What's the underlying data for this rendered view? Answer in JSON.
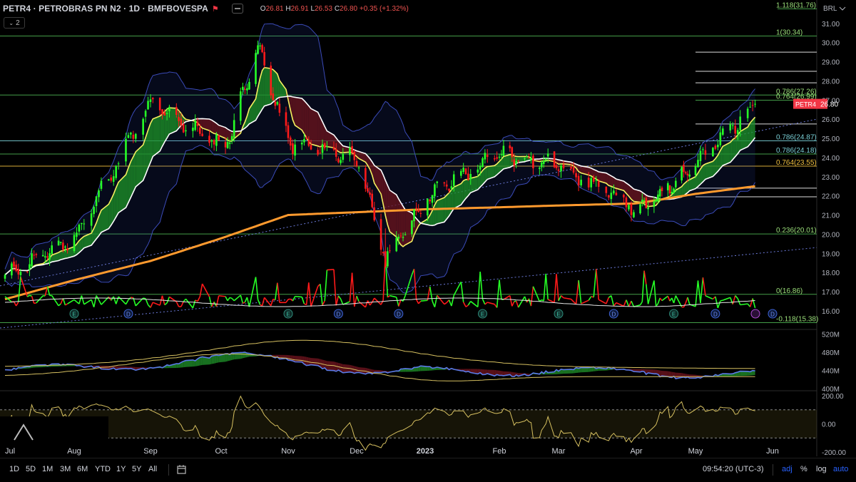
{
  "header": {
    "symbol": "PETR4 · PETROBRAS PN N2 · 1D · BMFBOVESPA",
    "ohlc": {
      "o_label": "O",
      "o": "26.81",
      "h_label": "H",
      "h": "26.91",
      "l_label": "L",
      "l": "26.53",
      "c_label": "C",
      "c": "26.80",
      "change": "+0.35 (+1.32%)"
    },
    "indicator_count": "2"
  },
  "currency": "BRL",
  "price_tag": {
    "symbol": "PETR4",
    "price": "26.80"
  },
  "bottom_bar": {
    "ranges": [
      "1D",
      "5D",
      "1M",
      "3M",
      "6M",
      "YTD",
      "1Y",
      "5Y",
      "All"
    ],
    "clock": "09:54:20 (UTC-3)",
    "options": [
      "adj",
      "%",
      "log",
      "auto"
    ]
  },
  "colors": {
    "up": "#26ff26",
    "down": "#ff1a1a",
    "price_tag": "#f23645",
    "ma_long": "#ff9a2e",
    "bands": "#3b4bb8",
    "fib": "#4caf50",
    "fib_gold": "#f0c040"
  },
  "chart_data": [
    {
      "type": "candlestick",
      "x_ticks": [
        "Jul",
        "Aug",
        "Sep",
        "Oct",
        "Nov",
        "Dec",
        "2023",
        "Feb",
        "Mar",
        "Apr",
        "May",
        "Jun"
      ],
      "y_ticks": [
        16,
        17,
        18,
        19,
        20,
        21,
        22,
        23,
        24,
        25,
        26,
        27,
        28,
        29,
        30,
        31
      ],
      "ylim": [
        15.4,
        31.4
      ],
      "last_price": 26.8,
      "anchor_dates": [
        "2022-07-01",
        "2022-08-01",
        "2022-09-01",
        "2022-10-03",
        "2022-10-18",
        "2022-11-01",
        "2022-12-01",
        "2022-12-14",
        "2023-01-02",
        "2023-02-01",
        "2023-03-01",
        "2023-04-03",
        "2023-05-02",
        "2023-05-25"
      ],
      "anchor_prices": [
        17.8,
        19.8,
        26.8,
        24.5,
        29.8,
        24.8,
        24.0,
        18.7,
        22.0,
        24.2,
        23.6,
        21.2,
        23.8,
        26.8
      ],
      "long_ma_anchor_dates": [
        "2022-07-01",
        "2022-09-01",
        "2022-11-01",
        "2023-01-02",
        "2023-04-01",
        "2023-05-25"
      ],
      "long_ma_anchor_values": [
        16.6,
        18.6,
        21.0,
        21.3,
        21.6,
        22.5
      ],
      "fib_levels": [
        {
          "label": "1.118(31.76)",
          "value": 31.76
        },
        {
          "label": "1(30.34)",
          "value": 30.34
        },
        {
          "label": "0.786(27.26)",
          "value": 27.26
        },
        {
          "label": "0.764(26.99)",
          "value": 26.99
        },
        {
          "label": "0.786(24.87)",
          "value": 24.87
        },
        {
          "label": "0.786(24.18)",
          "value": 24.18
        },
        {
          "label": "0.764(23.55)",
          "value": 23.55
        },
        {
          "label": "0.236(20.01)",
          "value": 20.01
        },
        {
          "label": "0(16.86)",
          "value": 16.86
        },
        {
          "label": "-0.118(15.38)",
          "value": 15.38
        }
      ],
      "event_markers": [
        "E",
        "D",
        "E",
        "D",
        "D",
        "E",
        "E",
        "D",
        "E",
        "D",
        "D"
      ],
      "event_marker_dates": [
        "2022-08-01",
        "2022-08-23",
        "2022-11-01",
        "2022-11-23",
        "2022-12-20",
        "2023-01-25",
        "2023-03-01",
        "2023-03-23",
        "2023-04-20",
        "2023-05-09",
        "2023-06-02"
      ]
    },
    {
      "type": "area",
      "y_ticks": [
        "520M",
        "480M",
        "440M",
        "400M"
      ],
      "ylim": [
        395,
        530
      ]
    },
    {
      "type": "line",
      "y_ticks": [
        "200.00",
        "0.00",
        "-200.00"
      ],
      "ylim": [
        -230,
        230
      ]
    }
  ]
}
